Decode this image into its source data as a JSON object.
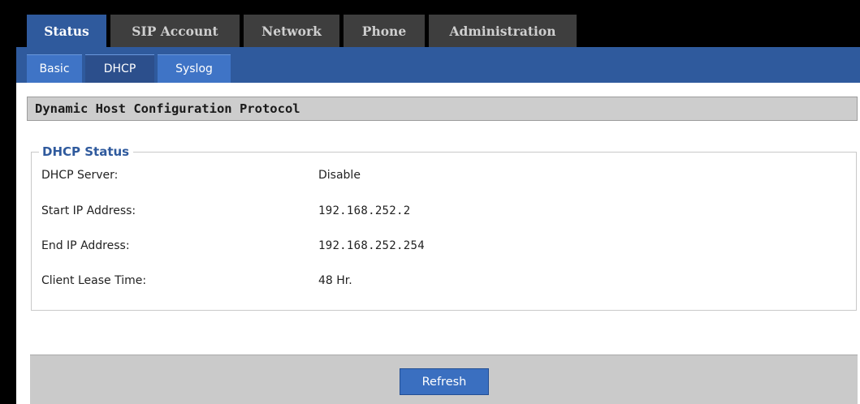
{
  "main_tabs": [
    {
      "label": "Status"
    },
    {
      "label": "SIP Account"
    },
    {
      "label": "Network"
    },
    {
      "label": "Phone"
    },
    {
      "label": "Administration"
    }
  ],
  "active_main_tab": "Status",
  "sub_tabs": [
    {
      "label": "Basic"
    },
    {
      "label": "DHCP"
    },
    {
      "label": "Syslog"
    }
  ],
  "active_sub_tab": "DHCP",
  "section": {
    "title": "Dynamic Host Configuration Protocol"
  },
  "dhcp_status": {
    "legend": "DHCP Status",
    "rows": [
      {
        "label": "DHCP Server:",
        "value": "Disable"
      },
      {
        "label": "Start IP Address:",
        "value": "192.168.252.2"
      },
      {
        "label": "End IP Address:",
        "value": "192.168.252.254"
      },
      {
        "label": "Client Lease Time:",
        "value": "48 Hr."
      }
    ]
  },
  "footer": {
    "refresh_label": "Refresh"
  },
  "colors": {
    "tab_active": "#2f5a9d",
    "tab_inactive": "#3e3e3e",
    "subtab": "#3f74c6",
    "subtab_active": "#2c4f8c",
    "legend_text": "#2f5a9d",
    "button": "#3a6fc0"
  }
}
